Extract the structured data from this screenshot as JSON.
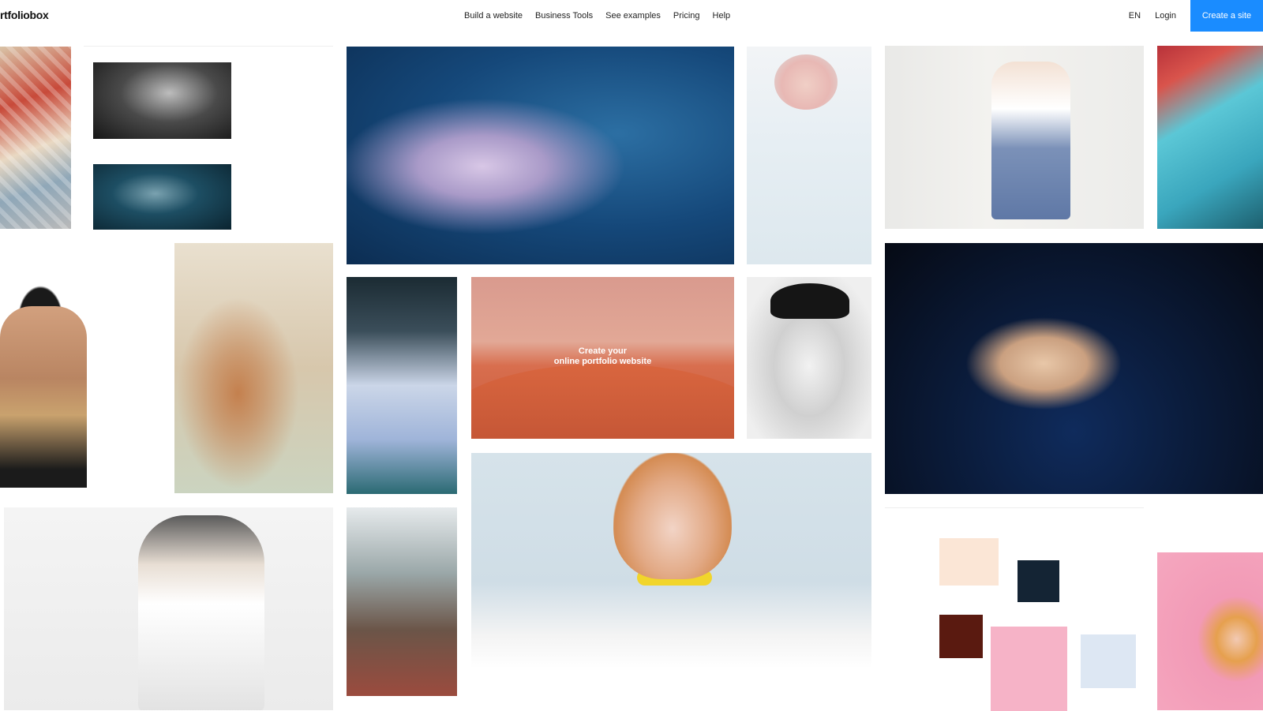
{
  "header": {
    "logo": "rtfoliobox",
    "nav": [
      "Build a website",
      "Business Tools",
      "See examples",
      "Pricing",
      "Help"
    ],
    "lang": "EN",
    "login": "Login",
    "cta": "Create a site"
  },
  "hero": {
    "line1": "Create your",
    "line2": "online portfolio website"
  },
  "colors": {
    "cta_background": "#1a8cff",
    "cta_text": "#ffffff",
    "background": "#ffffff"
  }
}
